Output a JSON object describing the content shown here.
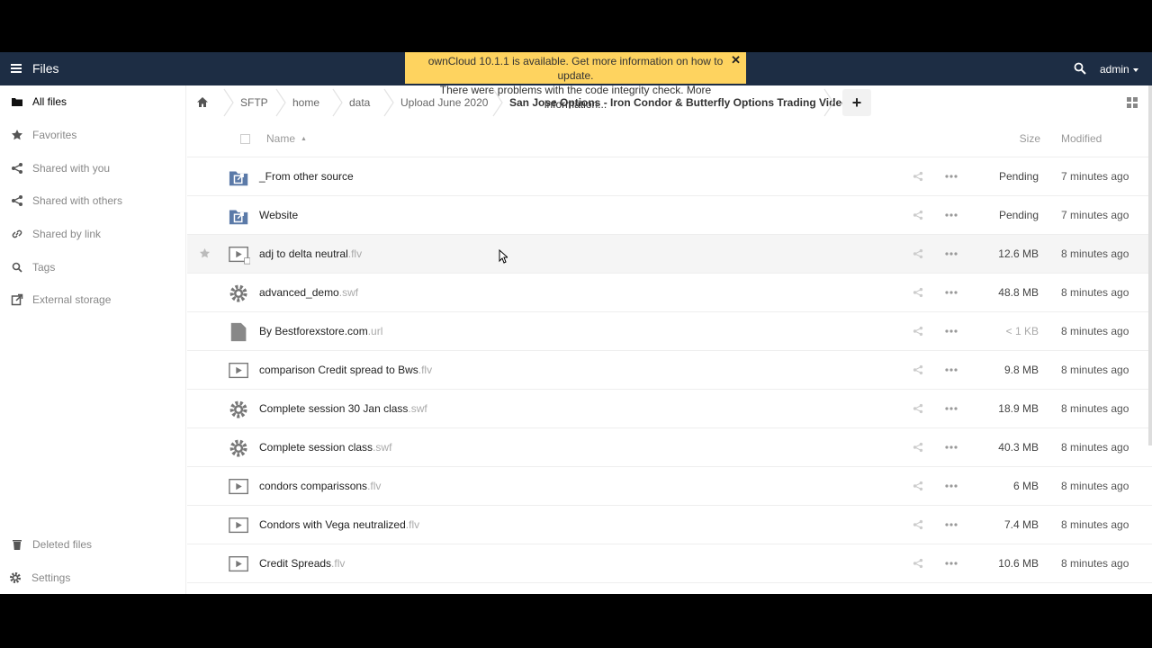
{
  "header": {
    "app_name": "Files",
    "notification_line1": "ownCloud 10.1.1 is available. Get more information on how to update.",
    "notification_line2": "There were problems with the code integrity check. More information...",
    "notification_close": "✕",
    "user": "admin",
    "search_icon": "search-icon"
  },
  "sidebar": {
    "items": [
      {
        "label": "All files",
        "icon": "folder-icon"
      },
      {
        "label": "Favorites",
        "icon": "star-icon"
      },
      {
        "label": "Shared with you",
        "icon": "share-icon"
      },
      {
        "label": "Shared with others",
        "icon": "share-icon"
      },
      {
        "label": "Shared by link",
        "icon": "link-icon"
      },
      {
        "label": "Tags",
        "icon": "tag-icon"
      },
      {
        "label": "External storage",
        "icon": "external-icon"
      }
    ],
    "bottom": [
      {
        "label": "Deleted files",
        "icon": "trash-icon"
      },
      {
        "label": "Settings",
        "icon": "gear-icon"
      }
    ]
  },
  "breadcrumb": {
    "items": [
      "SFTP",
      "home",
      "data",
      "Upload June 2020",
      "San Jose Options - Iron Condor & Butterfly Options Trading Videos"
    ],
    "new_label": "+"
  },
  "table": {
    "col_name": "Name",
    "col_size": "Size",
    "col_modified": "Modified",
    "rows": [
      {
        "name": "_From other source",
        "ext": "",
        "size": "Pending",
        "modified": "7 minutes ago",
        "type": "external-folder"
      },
      {
        "name": "Website",
        "ext": "",
        "size": "Pending",
        "modified": "7 minutes ago",
        "type": "external-folder"
      },
      {
        "name": "adj to delta neutral",
        "ext": ".flv",
        "size": "12.6 MB",
        "modified": "8 minutes ago",
        "type": "video"
      },
      {
        "name": "advanced_demo",
        "ext": ".swf",
        "size": "48.8 MB",
        "modified": "8 minutes ago",
        "type": "app"
      },
      {
        "name": "By Bestforexstore.com",
        "ext": ".url",
        "size": "< 1 KB",
        "modified": "8 minutes ago",
        "type": "file"
      },
      {
        "name": "comparison Credit spread to Bws",
        "ext": ".flv",
        "size": "9.8 MB",
        "modified": "8 minutes ago",
        "type": "video"
      },
      {
        "name": "Complete session 30 Jan class",
        "ext": ".swf",
        "size": "18.9 MB",
        "modified": "8 minutes ago",
        "type": "app"
      },
      {
        "name": "Complete session class",
        "ext": ".swf",
        "size": "40.3 MB",
        "modified": "8 minutes ago",
        "type": "app"
      },
      {
        "name": "condors comparissons",
        "ext": ".flv",
        "size": "6 MB",
        "modified": "8 minutes ago",
        "type": "video"
      },
      {
        "name": "Condors with Vega neutralized",
        "ext": ".flv",
        "size": "7.4 MB",
        "modified": "8 minutes ago",
        "type": "video"
      },
      {
        "name": "Credit Spreads",
        "ext": ".flv",
        "size": "10.6 MB",
        "modified": "8 minutes ago",
        "type": "video"
      }
    ]
  },
  "colors": {
    "header_bg": "#1d2d44",
    "notification_bg": "#fed35f",
    "folder_blue": "#5b7aa8"
  }
}
